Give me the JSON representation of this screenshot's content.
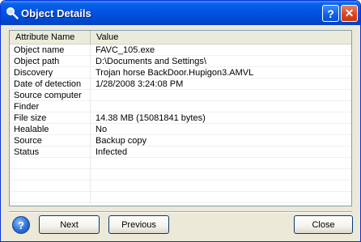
{
  "window": {
    "title": "Object Details",
    "help_label": "?",
    "close_label": "✕"
  },
  "table": {
    "columns": [
      "Attribute Name",
      "Value"
    ],
    "rows": [
      {
        "name": "Object name",
        "value": "FAVC_105.exe"
      },
      {
        "name": "Object path",
        "value": "D:\\Documents and Settings\\"
      },
      {
        "name": "Discovery",
        "value": "Trojan horse BackDoor.Hupigon3.AMVL"
      },
      {
        "name": "Date of detection",
        "value": "1/28/2008 3:24:08 PM"
      },
      {
        "name": "Source computer",
        "value": ""
      },
      {
        "name": "Finder",
        "value": ""
      },
      {
        "name": "File size",
        "value": "14.38 MB (15081841 bytes)"
      },
      {
        "name": "Healable",
        "value": "No"
      },
      {
        "name": "Source",
        "value": "Backup copy"
      },
      {
        "name": "Status",
        "value": "Infected"
      }
    ]
  },
  "buttons": {
    "help": "?",
    "next": "Next",
    "previous": "Previous",
    "close": "Close"
  },
  "colors": {
    "titlebar": "#0054e3",
    "face": "#ece9d8",
    "list_border": "#7f9db9"
  }
}
